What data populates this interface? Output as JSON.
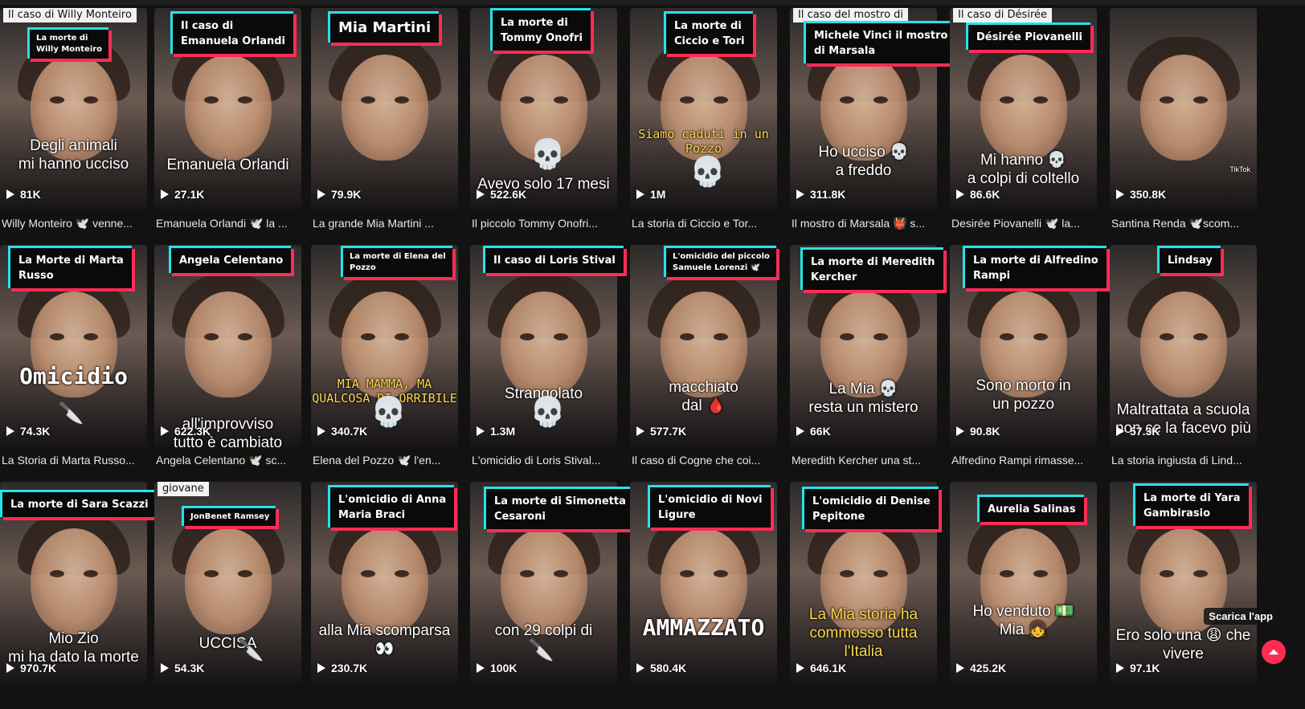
{
  "cards": [
    {
      "row": 0,
      "col": 0,
      "caption": "La morte di\nWilly Monteiro",
      "caption_top": "Il caso di Willy Monteiro",
      "overlay": "Degli animali\nmi hanno ucciso",
      "views": "81K",
      "desc": "Willy Monteiro 🕊️ venne..."
    },
    {
      "row": 0,
      "col": 1,
      "caption": "Il caso di\nEmanuela Orlandi",
      "overlay": "Emanuela Orlandi",
      "views": "27.1K",
      "desc": "Emanuela Orlandi 🕊️ la ..."
    },
    {
      "row": 0,
      "col": 2,
      "caption": "Mia Martini",
      "overlay": "",
      "views": "79.9K",
      "desc": "La grande Mia Martini ..."
    },
    {
      "row": 0,
      "col": 3,
      "caption": "La morte di\nTommy Onofri",
      "overlay": "Avevo solo 17 mesi",
      "views": "522.6K",
      "desc": "Il piccolo Tommy Onofri..."
    },
    {
      "row": 0,
      "col": 4,
      "caption": "La morte di\nCiccio e Tori",
      "overlay": "Siamo caduti in un\nPozzo",
      "views": "1M",
      "desc": "La storia di Ciccio e Tor..."
    },
    {
      "row": 0,
      "col": 5,
      "caption": "Michele Vinci il mostro\ndi Marsala",
      "caption_top": "Il caso del mostro di",
      "overlay": "Ho ucciso 💀\na freddo",
      "views": "311.8K",
      "desc": "Il mostro di Marsala 👹 s..."
    },
    {
      "row": 0,
      "col": 6,
      "caption": "Désirée Piovanelli",
      "caption_top": "Il caso di Désirée",
      "overlay": "Mi hanno 💀\na colpi di coltello",
      "views": "86.6K",
      "desc": "Desirée Piovanelli 🕊️ la..."
    },
    {
      "row": 0,
      "col": 7,
      "caption": "",
      "overlay": "",
      "views": "350.8K",
      "desc": "Santina Renda 🕊️scom...",
      "tiktok": "TikTok"
    },
    {
      "row": 1,
      "col": 0,
      "caption": "La Morte di Marta\nRusso",
      "overlay": "Omicidio",
      "views": "74.3K",
      "desc": "La Storia di Marta Russo..."
    },
    {
      "row": 1,
      "col": 1,
      "caption": "Angela Celentano",
      "overlay": "all'improvviso\ntutto è cambiato",
      "views": "622.3K",
      "desc": "Angela Celentano 🕊️ sc..."
    },
    {
      "row": 1,
      "col": 2,
      "caption": "La morte di Elena del\nPozzo",
      "overlay": "MIA MAMMA, MA QUALCOSA DI ORRIBILE\nÈ",
      "views": "340.7K",
      "desc": "Elena del Pozzo 🕊️ l'en..."
    },
    {
      "row": 1,
      "col": 3,
      "caption": "Il caso di Loris Stival",
      "overlay": "Strangolato",
      "views": "1.3M",
      "desc": "L'omicidio di Loris Stival..."
    },
    {
      "row": 1,
      "col": 4,
      "caption": "L'omicidio del piccolo\nSamuele Lorenzi 🕊️",
      "overlay": "macchiato\ndal 🩸",
      "views": "577.7K",
      "desc": "Il caso di Cogne che coi..."
    },
    {
      "row": 1,
      "col": 5,
      "caption": "La morte di Meredith\nKercher",
      "overlay": "La Mia 💀\nresta un mistero",
      "views": "66K",
      "desc": "Meredith Kercher una st..."
    },
    {
      "row": 1,
      "col": 6,
      "caption": "La morte di Alfredino\nRampi",
      "overlay": "Sono morto in\nun pozzo",
      "views": "90.8K",
      "desc": "Alfredino Rampi rimasse..."
    },
    {
      "row": 1,
      "col": 7,
      "caption": "Lindsay",
      "overlay": "Maltrattata a scuola\nnon ce la facevo più",
      "views": "57.3K",
      "desc": "La storia ingiusta di Lind..."
    },
    {
      "row": 2,
      "col": 0,
      "caption": "La morte di Sara Scazzi",
      "overlay": "Mio Zio\nmi ha dato la morte",
      "views": "970.7K",
      "desc": ""
    },
    {
      "row": 2,
      "col": 1,
      "caption": "JonBenet Ramsey",
      "caption_top": "giovane",
      "overlay": "UCCISA",
      "views": "54.3K",
      "desc": ""
    },
    {
      "row": 2,
      "col": 2,
      "caption": "L'omicidio di Anna\nMaria Braci",
      "overlay": "alla Mia scomparsa 👀",
      "views": "230.7K",
      "desc": ""
    },
    {
      "row": 2,
      "col": 3,
      "caption": "La morte di Simonetta\nCesaroni",
      "overlay": "con 29 colpi di",
      "views": "100K",
      "desc": ""
    },
    {
      "row": 2,
      "col": 4,
      "caption": "L'omicidio di Novi\nLigure",
      "overlay": "AMMAZZATO",
      "views": "580.4K",
      "desc": ""
    },
    {
      "row": 2,
      "col": 5,
      "caption": "L'omicidio di Denise\nPepitone",
      "overlay": "La Mia storia ha\ncommosso tutta l'Italia",
      "views": "646.1K",
      "desc": ""
    },
    {
      "row": 2,
      "col": 6,
      "caption": "Aurelia Salinas",
      "overlay": "Ho venduto 💵\nMia 👧",
      "views": "425.2K",
      "desc": ""
    },
    {
      "row": 2,
      "col": 7,
      "caption": "La morte di Yara\nGambirasio",
      "overlay": "Ero solo una 😩 che\nvivere",
      "views": "97.1K",
      "desc": ""
    }
  ],
  "ui": {
    "download_label": "Scarica l'app",
    "scroll_top_icon": "arrow-up-icon",
    "accent_cyan": "#25e3e8",
    "accent_red": "#fe2c55"
  }
}
